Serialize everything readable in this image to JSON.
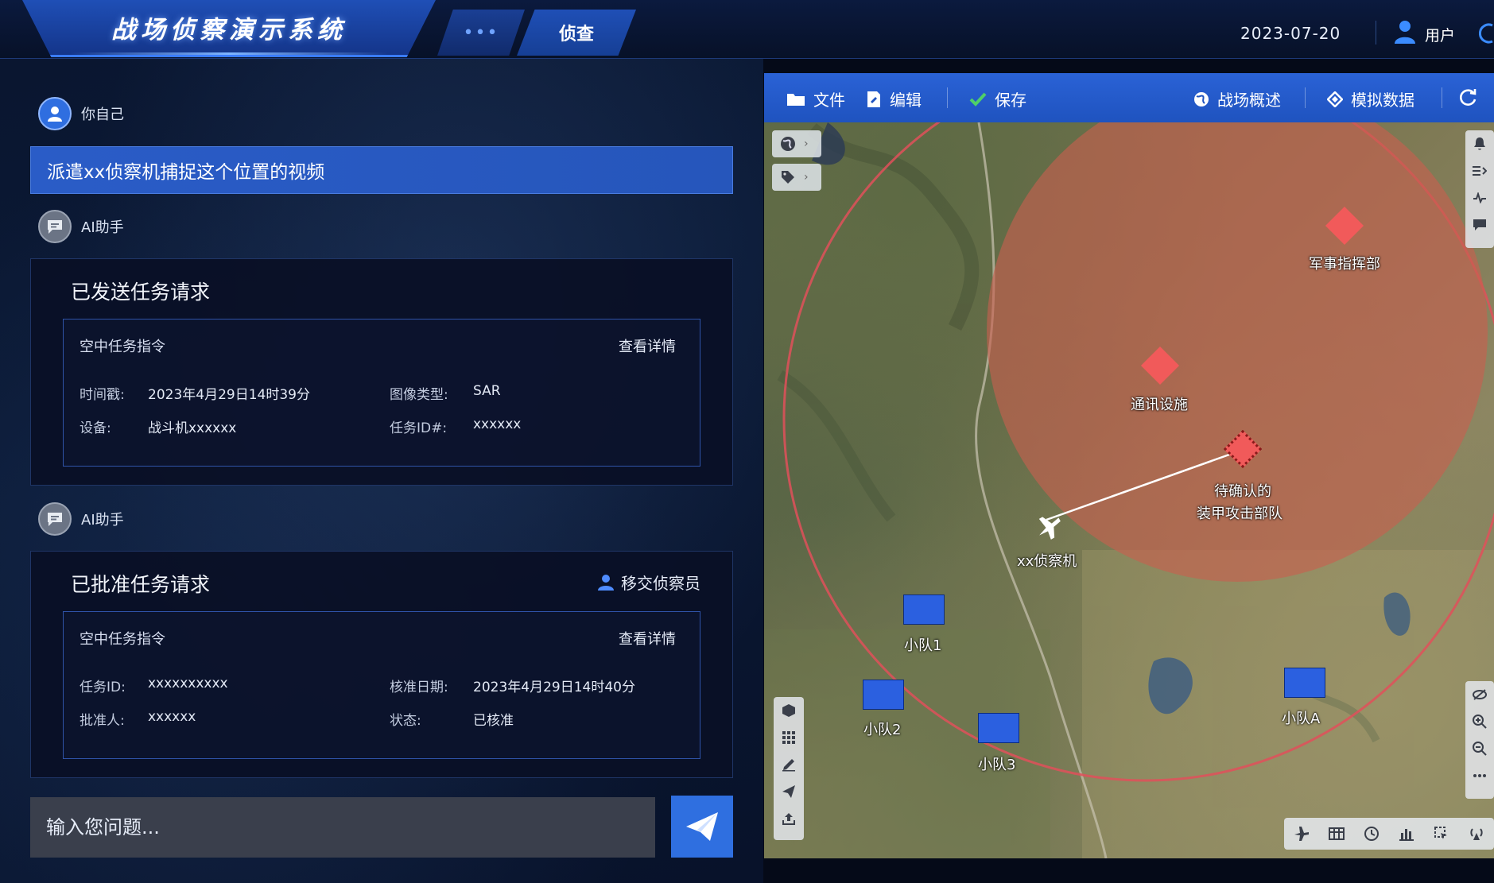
{
  "header": {
    "app_title": "战场侦察演示系统",
    "tab_more": "•••",
    "tab_recon": "侦查",
    "date": "2023-07-20",
    "user_label": "用户"
  },
  "chat": {
    "user_name": "你自己",
    "user_message": "派遣xx侦察机捕捉这个位置的视频",
    "ai_name": "AI助手",
    "card1": {
      "title": "已发送任务请求",
      "inner_title": "空中任务指令",
      "detail_link": "查看详情",
      "rows": [
        {
          "label": "时间戳:",
          "value": "2023年4月29日14时39分"
        },
        {
          "label": "图像类型:",
          "value": "SAR"
        },
        {
          "label": "设备:",
          "value": "战斗机xxxxxx"
        },
        {
          "label": "任务ID#:",
          "value": "xxxxxx"
        }
      ]
    },
    "card2": {
      "title": "已批准任务请求",
      "handover": "移交侦察员",
      "inner_title": "空中任务指令",
      "detail_link": "查看详情",
      "rows": [
        {
          "label": "任务ID:",
          "value": "xxxxxxxxxx"
        },
        {
          "label": "核准日期:",
          "value": "2023年4月29日14时40分"
        },
        {
          "label": "批准人:",
          "value": "xxxxxx"
        },
        {
          "label": "状态:",
          "value": "已核准"
        }
      ]
    },
    "input_placeholder": "输入您问题..."
  },
  "map": {
    "toolbar": {
      "file": "文件",
      "edit": "编辑",
      "save": "保存",
      "overview": "战场概述",
      "simulate": "模拟数据"
    },
    "labels": {
      "hq": "军事指挥部",
      "comms": "通讯设施",
      "armor_line1": "待确认的",
      "armor_line2": "装甲攻击部队",
      "recon_plane": "xx侦察机",
      "squad1": "小队1",
      "squad2": "小队2",
      "squad3": "小队3",
      "squadA": "小队A"
    }
  },
  "colors": {
    "accent_blue": "#2f6fe0",
    "target_red": "#f15a5a",
    "zone_fill": "#c8604f",
    "zone_ring": "#e0505a",
    "unit_blue": "#2b60e0"
  },
  "icons": {
    "user": "person-icon",
    "ai": "chat-bubble-icon",
    "send": "paper-plane-icon",
    "aircraft": "airplane-icon"
  }
}
